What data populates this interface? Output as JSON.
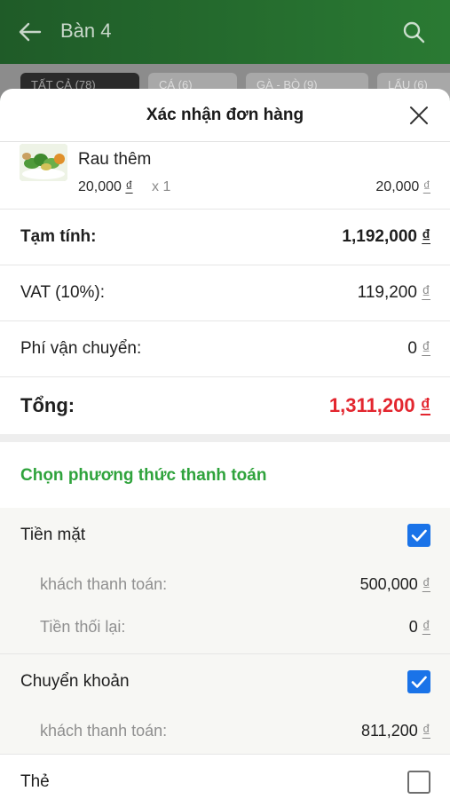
{
  "appbar": {
    "title": "Bàn 4"
  },
  "tabs": [
    {
      "label": "TẤT CẢ (78)"
    },
    {
      "label": "CÁ (6)"
    },
    {
      "label": "GÀ - BÒ (9)"
    },
    {
      "label": "LẨU (6)"
    }
  ],
  "sheet": {
    "title": "Xác nhận đơn hàng"
  },
  "item": {
    "name": "Rau thêm",
    "price": "20,000",
    "qty": "x 1",
    "total": "20,000"
  },
  "currency": "₫",
  "summary": {
    "subtotal_label": "Tạm tính:",
    "subtotal_value": "1,192,000",
    "vat_label": "VAT (10%):",
    "vat_value": "119,200",
    "shipping_label": "Phí vận chuyển:",
    "shipping_value": "0",
    "total_label": "Tổng:",
    "total_value": "1,311,200"
  },
  "payment": {
    "heading": "Chọn phương thức thanh toán",
    "cash": {
      "label": "Tiền mặt",
      "checked": true,
      "paid_label": "khách thanh toán:",
      "paid_value": "500,000",
      "change_label": "Tiền thối lại:",
      "change_value": "0"
    },
    "transfer": {
      "label": "Chuyển khoản",
      "checked": true,
      "paid_label": "khách thanh toán:",
      "paid_value": "811,200"
    },
    "card": {
      "label": "Thẻ",
      "checked": false
    }
  },
  "colors": {
    "appbar": "#2a7a33",
    "accent_green": "#2fa33c",
    "total_red": "#e3262f",
    "checkbox_blue": "#1a73e8"
  }
}
